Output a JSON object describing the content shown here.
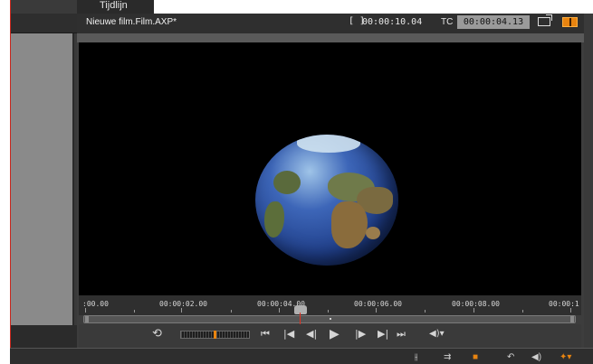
{
  "tabs": {
    "timeline_label": "Tijdlijn"
  },
  "player": {
    "title": "Nieuwe film.Film.AXP*",
    "duration_icon": "[ ]",
    "duration": "00:00:10.04",
    "tc_label": "TC",
    "timecode": "00:00:04.13",
    "detach_icon": "external-window-icon",
    "dual_view_icon": "dual-preview-icon"
  },
  "ruler": {
    "ticks": [
      ":00.00",
      "00:00:02.00",
      "00:00:04.00",
      "00:00:06.00",
      "00:00:08.00",
      "00:00:1"
    ],
    "playhead_value": "00:00:04.13"
  },
  "transport": {
    "loop": "⟲",
    "go_start": "⏮",
    "prev_frame": "|◀",
    "step_back": "◀|",
    "play": "▶",
    "step_forward": "|▶",
    "next_frame": "▶|",
    "go_end": "⏭",
    "volume": "◀)▾"
  },
  "bottom": {
    "icons": [
      "split-icon",
      "trim-icon",
      "marker-icon",
      "undo-icon",
      "audio-icon",
      "fx-icon"
    ],
    "glyphs": [
      "⫲",
      "⇉",
      "■",
      "↶",
      "◀)",
      "✦▾"
    ]
  },
  "colors": {
    "accent": "#e88410",
    "playhead": "#e03020",
    "background": "#3d3d3d"
  }
}
